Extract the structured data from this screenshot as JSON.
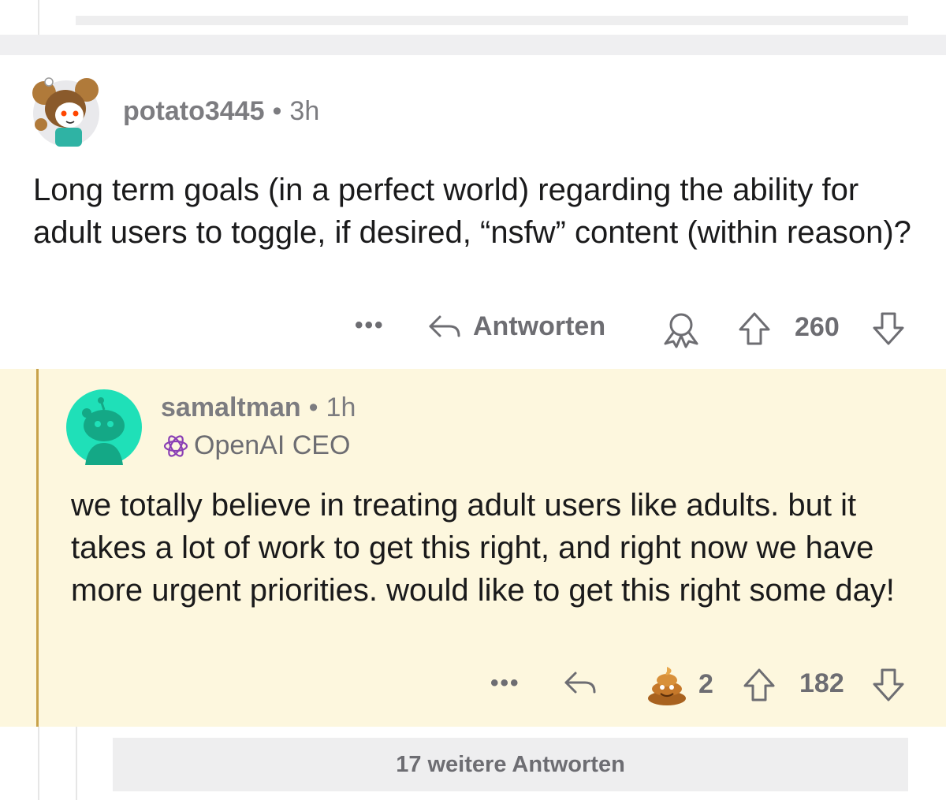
{
  "comment": {
    "username": "potato3445",
    "separator": "•",
    "time": "3h",
    "avatar_icon": "snoo-avatar-icon",
    "body": "Long term goals (in a perfect world) regarding the ability for adult users to toggle, if desired, “nsfw” content (within reason)?",
    "actions": {
      "more_label": "•••",
      "reply_label": "Antworten",
      "award_icon": "award-icon",
      "score": "260"
    }
  },
  "reply": {
    "username": "samaltman",
    "separator": "•",
    "time": "1h",
    "avatar_icon": "snoo-avatar-icon",
    "flair_icon": "openai-logo-icon",
    "flair": "OpenAI CEO",
    "body": "we totally believe in treating adult users like adults. but it takes a lot of work to get this right, and right now we have more urgent priorities. would like to get this right some day!",
    "actions": {
      "more_label": "•••",
      "award_icon": "poop-award-icon",
      "award_count": "2",
      "score": "182"
    }
  },
  "more_replies_label": "17 weitere Antworten",
  "colors": {
    "reply_background": "#fdf7de",
    "reply_accent_line": "#c8a24a",
    "meta_text": "#7c7c80",
    "action_text": "#6d6d72"
  }
}
